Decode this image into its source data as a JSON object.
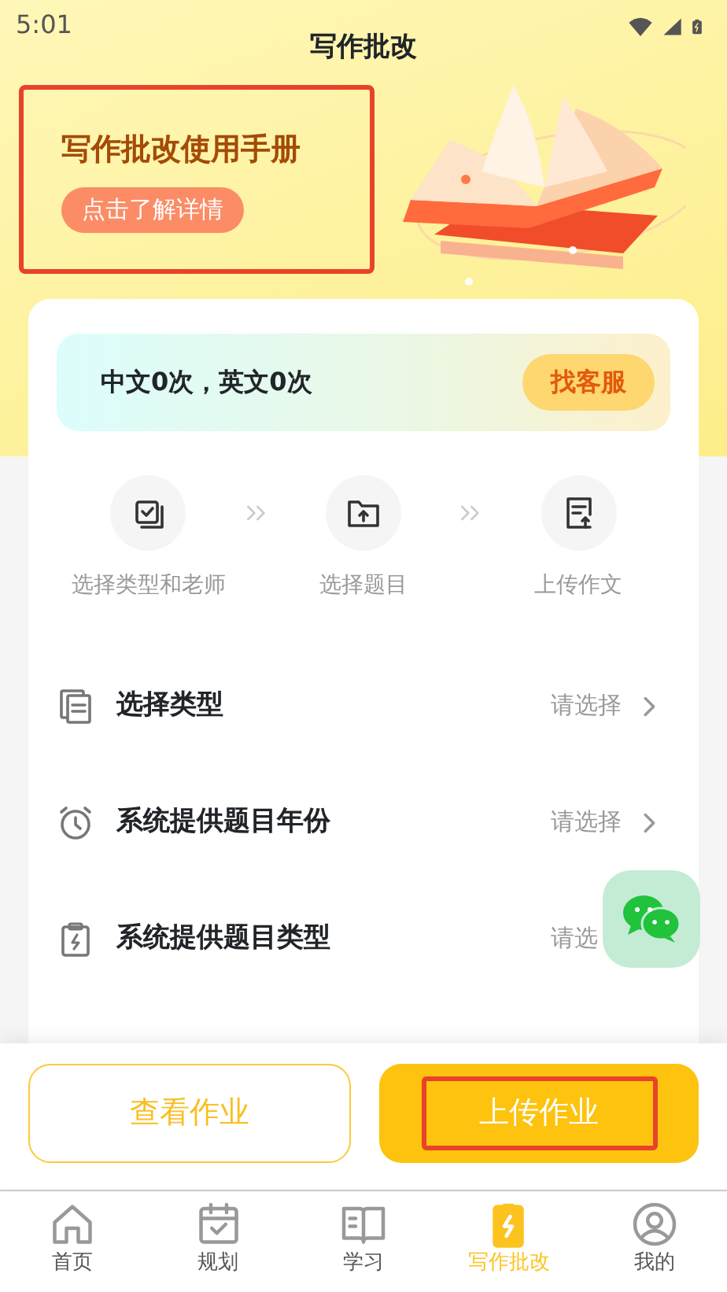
{
  "status_bar": {
    "time": "5:01"
  },
  "title": "写作批改",
  "manual_banner": {
    "title": "写作批改使用手册",
    "button": "点击了解详情",
    "highlighted": true
  },
  "quota": {
    "text": "中文0次，英文0次",
    "button": "找客服"
  },
  "steps": [
    {
      "label": "选择类型和老师",
      "kind": "checklist"
    },
    {
      "label": "选择题目",
      "kind": "folder"
    },
    {
      "label": "上传作文",
      "kind": "file"
    }
  ],
  "form_rows": [
    {
      "label": "选择类型",
      "value": "请选择",
      "kind": "document",
      "chevron": true
    },
    {
      "label": "系统提供题目年份",
      "value": "请选择",
      "kind": "clock",
      "chevron": true
    },
    {
      "label": "系统提供题目类型",
      "value": "请选",
      "kind": "clipboard"
    }
  ],
  "actions": [
    {
      "label": "查看作业",
      "kind": "outline",
      "highlighted": false
    },
    {
      "label": "上传作业",
      "kind": "filled",
      "highlighted": true
    }
  ],
  "tabs": [
    {
      "label": "首页",
      "kind": "home",
      "selected": false
    },
    {
      "label": "规划",
      "kind": "calendar",
      "selected": false
    },
    {
      "label": "学习",
      "kind": "book",
      "selected": false
    },
    {
      "label": "写作批改",
      "kind": "bolt",
      "selected": true
    },
    {
      "label": "我的",
      "kind": "user",
      "selected": false
    }
  ]
}
